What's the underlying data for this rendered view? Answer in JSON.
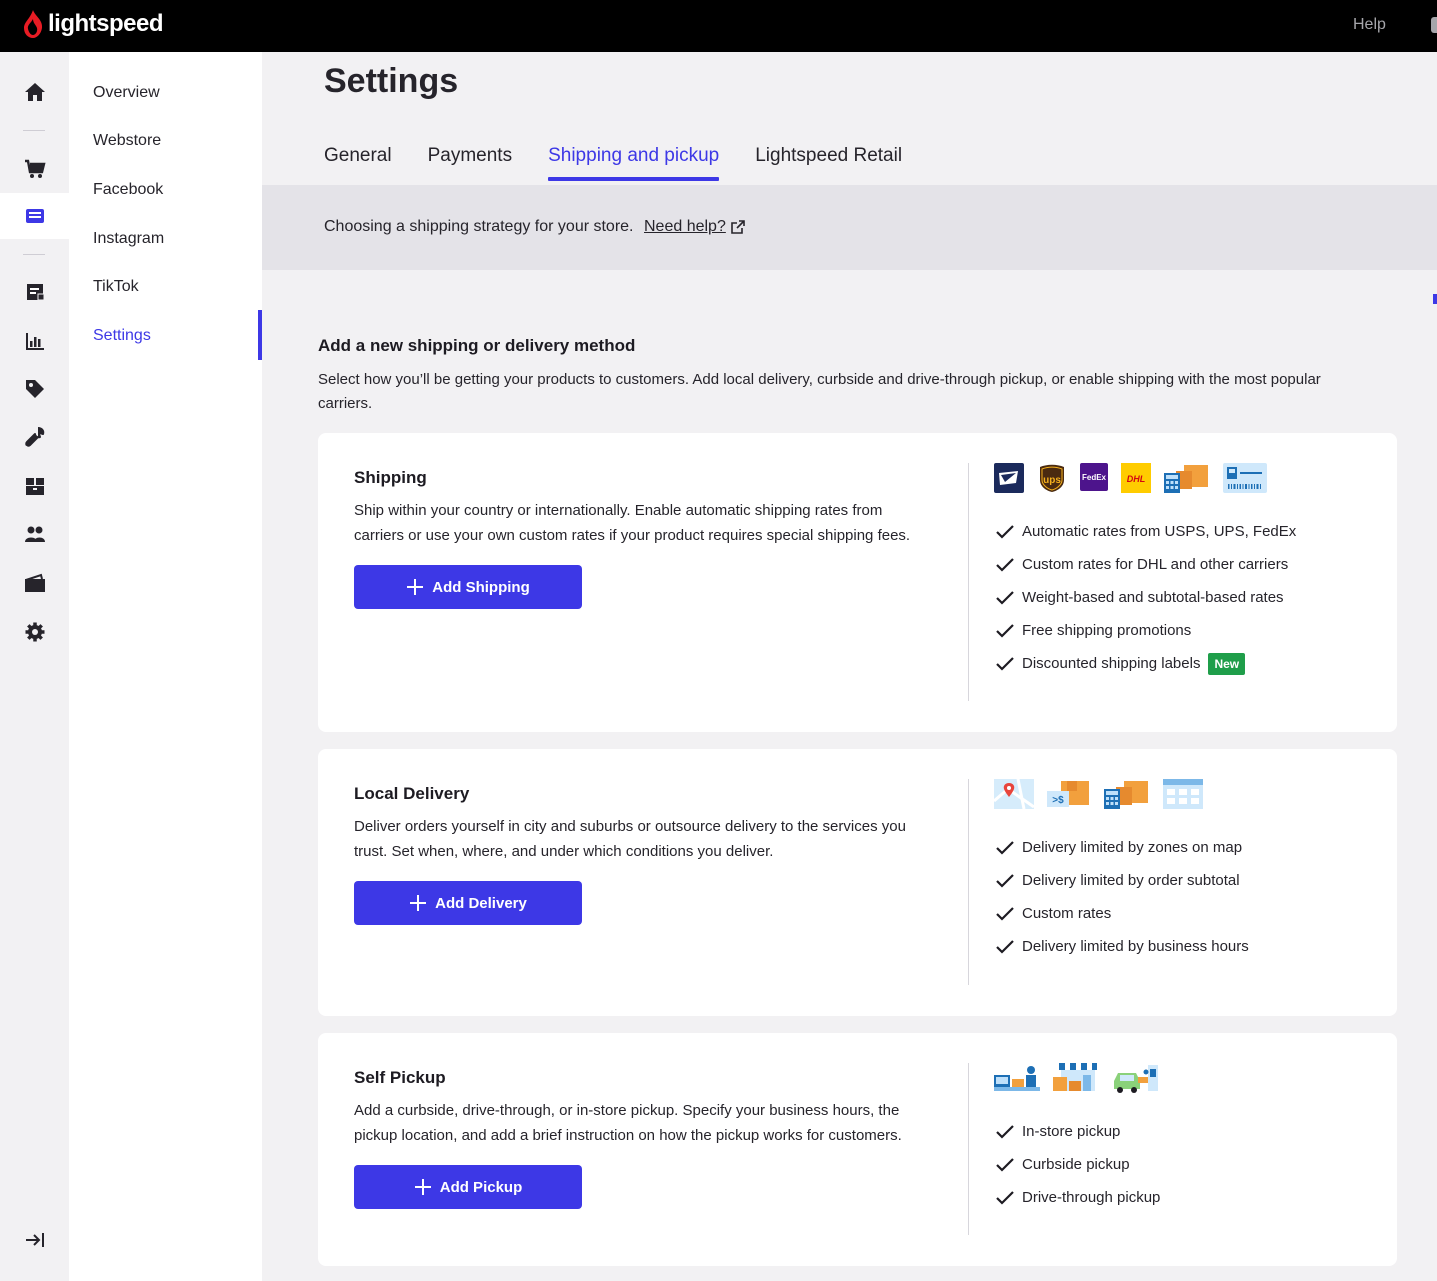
{
  "app": {
    "brand": "lightspeed",
    "help_label": "Help"
  },
  "colors": {
    "accent": "#3d38e6",
    "brand_red": "#e81c24",
    "badge_green": "#1f9e4a",
    "topbar": "#000000"
  },
  "rail": [
    {
      "icon": "home-icon"
    },
    {
      "icon": "cart-icon"
    },
    {
      "icon": "storefront-icon",
      "active": true
    },
    {
      "icon": "orders-icon"
    },
    {
      "icon": "reports-icon"
    },
    {
      "icon": "tag-icon"
    },
    {
      "icon": "wrench-icon"
    },
    {
      "icon": "inventory-icon"
    },
    {
      "icon": "customers-icon"
    },
    {
      "icon": "wallet-icon"
    },
    {
      "icon": "gear-icon"
    },
    {
      "icon": "collapse-icon"
    }
  ],
  "subnav": {
    "items": [
      {
        "label": "Overview"
      },
      {
        "label": "Webstore"
      },
      {
        "label": "Facebook"
      },
      {
        "label": "Instagram"
      },
      {
        "label": "TikTok"
      },
      {
        "label": "Settings",
        "active": true
      }
    ]
  },
  "page": {
    "title": "Settings",
    "tabs": [
      {
        "label": "General"
      },
      {
        "label": "Payments"
      },
      {
        "label": "Shipping and pickup",
        "active": true
      },
      {
        "label": "Lightspeed Retail"
      }
    ],
    "banner": {
      "text": "Choosing a shipping strategy for your store.",
      "link": "Need help?"
    },
    "section": {
      "title": "Add a new shipping or delivery method",
      "description": "Select how you’ll be getting your products to customers. Add local delivery, curbside and drive-through pickup, or enable shipping with the most popular carriers."
    }
  },
  "cards": {
    "shipping": {
      "title": "Shipping",
      "description": "Ship within your country or internationally. Enable automatic shipping rates from carriers or use your own custom rates if your product requires special shipping fees.",
      "button": "Add Shipping",
      "icons": [
        "usps-icon",
        "ups-icon",
        "fedex-icon",
        "dhl-icon",
        "calculator-box-icon",
        "shipping-label-icon"
      ],
      "carrier_labels": {
        "ups": "ups",
        "fedex": "FedEx",
        "dhl": "DHL"
      },
      "features": [
        "Automatic rates from USPS, UPS, FedEx",
        "Custom rates for DHL and other carriers",
        "Weight-based and subtotal-based rates",
        "Free shipping promotions",
        "Discounted shipping labels"
      ],
      "new_badge": "New"
    },
    "delivery": {
      "title": "Local Delivery",
      "description": "Deliver orders yourself in city and suburbs or outsource delivery to the services you trust. Set when, where, and under which conditions you deliver.",
      "button": "Add Delivery",
      "icons": [
        "map-pin-icon",
        "subtotal-box-icon",
        "calculator-box-icon",
        "calendar-icon"
      ],
      "subtotal_glyph": ">$",
      "features": [
        "Delivery limited by zones on map",
        "Delivery limited by order subtotal",
        "Custom rates",
        "Delivery limited by business hours"
      ]
    },
    "pickup": {
      "title": "Self Pickup",
      "description": "Add a curbside, drive-through, or in-store pickup. Specify your business hours, the pickup location, and add a brief instruction on how the pickup works for customers.",
      "button": "Add Pickup",
      "icons": [
        "in-store-pickup-icon",
        "curbside-pickup-icon",
        "drive-through-icon"
      ],
      "features": [
        "In-store pickup",
        "Curbside pickup",
        "Drive-through pickup"
      ]
    }
  }
}
